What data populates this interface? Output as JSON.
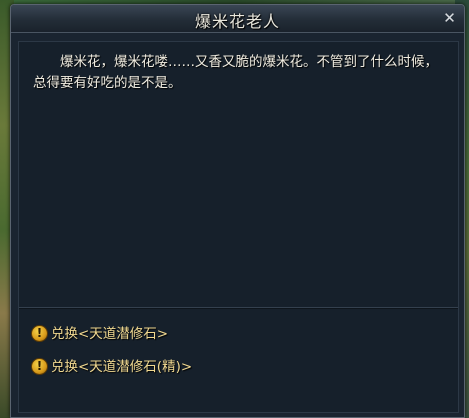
{
  "dialog": {
    "title": "爆米花老人",
    "close_glyph": "✕",
    "description": "爆米花，爆米花喽……又香又脆的爆米花。不管到了什么时候，总得要有好吃的是不是。"
  },
  "options": [
    {
      "icon": "quest-exclamation-icon",
      "icon_glyph": "!",
      "label": "兑换<天道潜修石>"
    },
    {
      "icon": "quest-exclamation-icon",
      "icon_glyph": "!",
      "label": "兑换<天道潜修石(精)>"
    }
  ],
  "colors": {
    "panel_bg": "#16202b",
    "text": "#f0ece0",
    "option_text": "#f0d890",
    "icon_gold": "#d89a1a"
  }
}
